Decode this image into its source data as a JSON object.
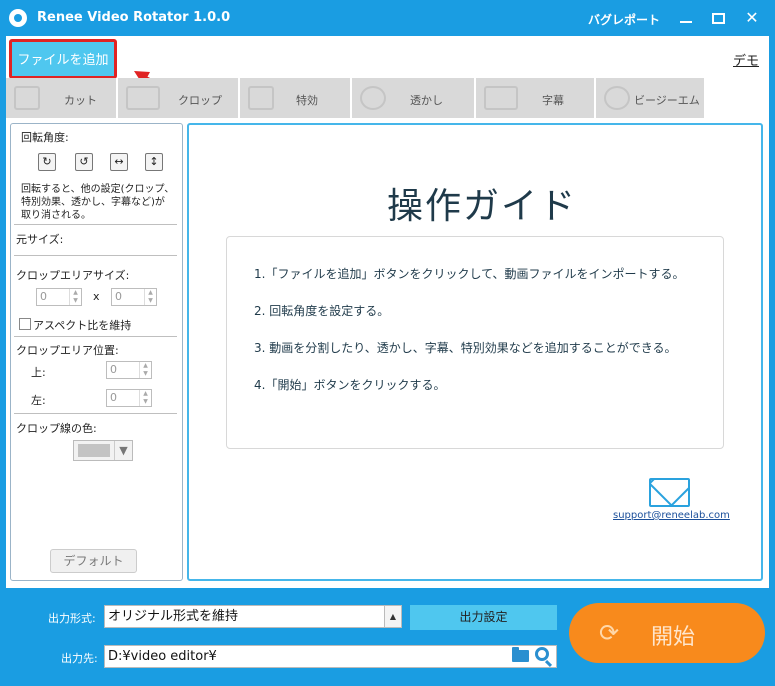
{
  "window": {
    "title": "Renee Video Rotator 1.0.0",
    "bug_report": "バグレポート"
  },
  "top": {
    "add_file": "ファイルを追加",
    "demo": "デモ"
  },
  "tabs": [
    {
      "label": "カット",
      "icon": "cut-icon"
    },
    {
      "label": "クロップ",
      "icon": "crop-icon"
    },
    {
      "label": "特効",
      "icon": "effect-icon"
    },
    {
      "label": "透かし",
      "icon": "watermark-icon"
    },
    {
      "label": "字幕",
      "icon": "subtitle-icon"
    },
    {
      "label": "ビージーエム",
      "icon": "bgm-icon"
    }
  ],
  "left_panel": {
    "rotation_title": "回転角度:",
    "rotation_note_1": "回転すると、他の設定(クロップ、",
    "rotation_note_2": "特別効果、透かし、字幕など)が",
    "rotation_note_3": "取り消される。",
    "original_size": "元サイズ:",
    "crop_area_size": "クロップエリアサイズ:",
    "width_value": "0",
    "height_value": "0",
    "x_label": "x",
    "keep_aspect": "アスペクト比を維持",
    "crop_area_position": "クロップエリア位置:",
    "top_label": "上:",
    "top_value": "0",
    "left_label": "左:",
    "left_value": "0",
    "crop_line_color": "クロップ線の色:",
    "default_button": "デフォルト"
  },
  "guide": {
    "title": "操作ガイド",
    "steps": [
      "1.「ファイルを追加」ボタンをクリックして、動画ファイルをインポートする。",
      "2. 回転角度を設定する。",
      "3. 動画を分割したり、透かし、字幕、特別効果などを追加することができる。",
      "4.「開始」ボタンをクリックする。"
    ],
    "support_email": "support@reneelab.com"
  },
  "bottom": {
    "output_format_label": "出力形式:",
    "output_format_value": "オリジナル形式を維持",
    "output_settings": "出力設定",
    "output_dest_label": "出力先:",
    "output_dest_value": "D:¥video editor¥",
    "start": "開始"
  },
  "colors": {
    "titlebar": "#1a9de2",
    "accent_button": "#4fc7ef",
    "start_button": "#f88a1c",
    "highlight_border": "#e02323"
  }
}
